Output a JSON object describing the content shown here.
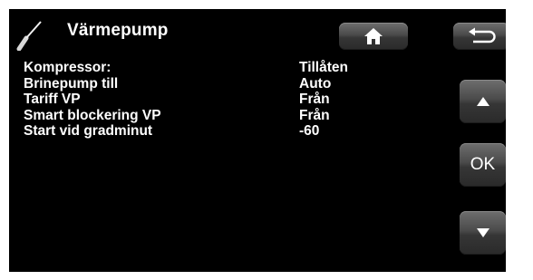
{
  "header": {
    "title": "Värmepump",
    "icon": "screwdriver-icon"
  },
  "nav": {
    "home_icon": "home-icon",
    "back_icon": "back-arrow-icon"
  },
  "side_buttons": {
    "up_icon": "triangle-up-icon",
    "ok_label": "OK",
    "down_icon": "triangle-down-icon"
  },
  "settings": [
    {
      "label": "Kompressor:",
      "value": "Tillåten"
    },
    {
      "label": "Brinepump till",
      "value": "Auto"
    },
    {
      "label": "Tariff VP",
      "value": "Från"
    },
    {
      "label": "Smart blockering VP",
      "value": "Från"
    },
    {
      "label": "Start vid gradminut",
      "value": "-60"
    }
  ],
  "colors": {
    "screen_background": "#000000",
    "text": "#ffffff",
    "button_top": "#6e6e6e",
    "button_bottom": "#2a2a2a"
  }
}
